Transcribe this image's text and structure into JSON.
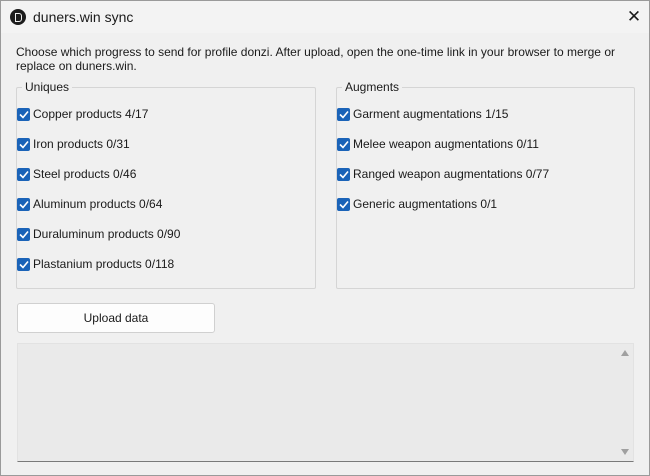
{
  "window": {
    "title": "duners.win sync",
    "close_glyph": "✕"
  },
  "intro_text": "Choose which progress to send for profile donzi. After upload, open the one-time link in your browser to merge or replace on duners.win.",
  "uniques": {
    "label": "Uniques",
    "items": [
      {
        "label": "Copper products  4/17",
        "checked": true
      },
      {
        "label": "Iron products  0/31",
        "checked": true
      },
      {
        "label": "Steel products  0/46",
        "checked": true
      },
      {
        "label": "Aluminum products  0/64",
        "checked": true
      },
      {
        "label": "Duraluminum products  0/90",
        "checked": true
      },
      {
        "label": "Plastanium products  0/118",
        "checked": true
      }
    ]
  },
  "augments": {
    "label": "Augments",
    "items": [
      {
        "label": "Garment augmentations  1/15",
        "checked": true
      },
      {
        "label": "Melee weapon augmentations  0/11",
        "checked": true
      },
      {
        "label": "Ranged weapon augmentations  0/77",
        "checked": true
      },
      {
        "label": "Generic augmentations  0/1",
        "checked": true
      }
    ]
  },
  "upload_button": "Upload data",
  "log_text": "",
  "colors": {
    "checkbox": "#1a63b8",
    "background": "#f0f0f0"
  }
}
